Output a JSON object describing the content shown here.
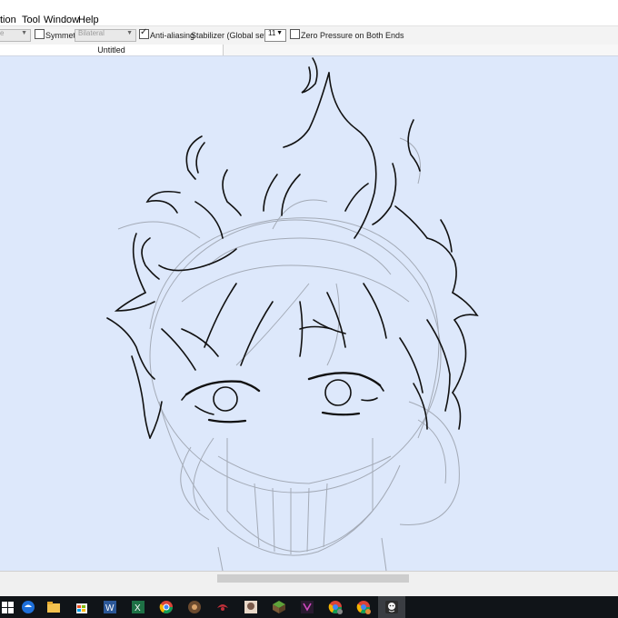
{
  "menubar": {
    "items": [
      {
        "label": "tion"
      },
      {
        "label": "Tool"
      },
      {
        "label": "Window"
      },
      {
        "label": "Help"
      }
    ]
  },
  "toolbar": {
    "first_select_value": "e",
    "symmetry_label": "Symmetry",
    "symmetry_checked": false,
    "symmetry_mode_value": "Bilateral",
    "antialiasing_label": "Anti-aliasing",
    "antialiasing_checked": true,
    "stabilizer_label": "Stabilizer (Global settings)",
    "stabilizer_value": "11",
    "zero_pressure_label": "Zero Pressure on Both Ends",
    "zero_pressure_checked": false
  },
  "document": {
    "tab_title": "Untitled"
  },
  "canvas": {
    "background_color": "#dde8fb",
    "content": "anime-boy-head-sketch"
  },
  "taskbar": {
    "apps": [
      {
        "icon": "windows-start-icon"
      },
      {
        "icon": "edge-icon"
      },
      {
        "icon": "file-explorer-icon"
      },
      {
        "icon": "store-icon"
      },
      {
        "icon": "word-icon"
      },
      {
        "icon": "excel-icon"
      },
      {
        "icon": "chrome-icon"
      },
      {
        "icon": "app-icon-1"
      },
      {
        "icon": "app-icon-2"
      },
      {
        "icon": "app-icon-3"
      },
      {
        "icon": "minecraft-icon"
      },
      {
        "icon": "app-icon-4"
      },
      {
        "icon": "chrome-profile-icon-1"
      },
      {
        "icon": "chrome-profile-icon-2"
      },
      {
        "icon": "firealpaca-icon"
      }
    ]
  }
}
